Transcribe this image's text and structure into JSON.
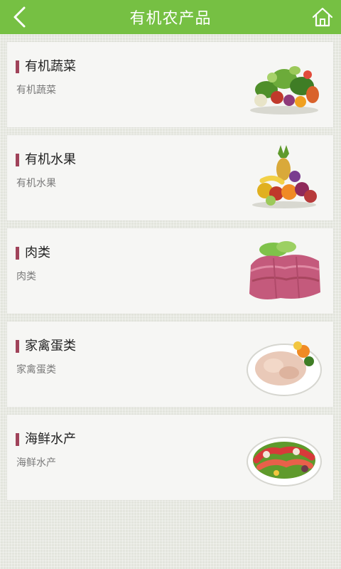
{
  "header": {
    "title": "有机农产品",
    "back_icon": "chevron-left-icon",
    "home_icon": "home-icon",
    "color": "#76c043"
  },
  "categories": [
    {
      "name": "有机蔬菜",
      "subtitle": "有机蔬菜",
      "image": "vegetables-image"
    },
    {
      "name": "有机水果",
      "subtitle": "有机水果",
      "image": "fruits-image"
    },
    {
      "name": "肉类",
      "subtitle": "肉类",
      "image": "meat-image"
    },
    {
      "name": "家禽蛋类",
      "subtitle": "家禽蛋类",
      "image": "poultry-image"
    },
    {
      "name": "海鲜水产",
      "subtitle": "海鲜水产",
      "image": "seafood-image"
    }
  ],
  "accent_bar_color": "#a0435a"
}
